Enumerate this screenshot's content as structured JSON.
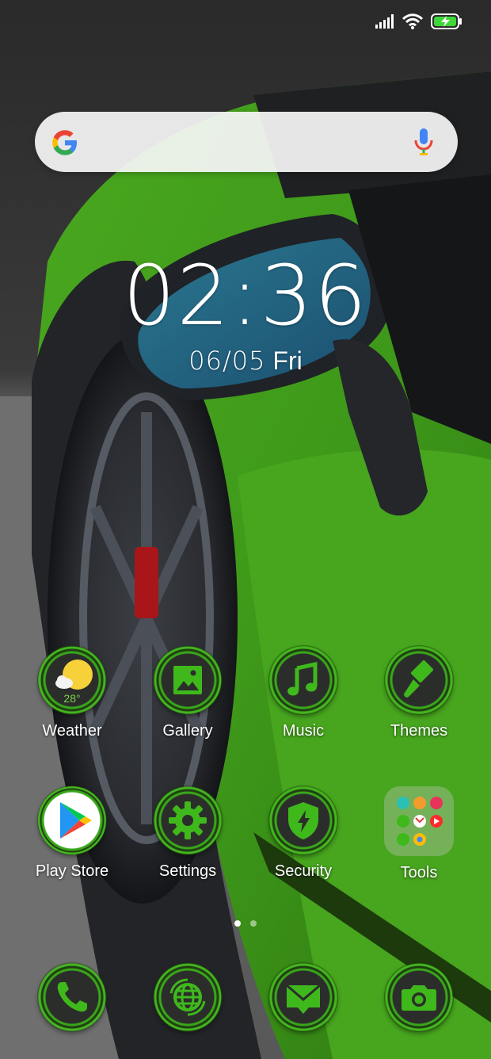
{
  "status_bar": {
    "icons": [
      "signal-icon",
      "wifi-icon",
      "battery-charging-icon"
    ]
  },
  "search": {
    "placeholder": "",
    "logo": "google-g-icon",
    "mic": "mic-icon"
  },
  "clock": {
    "time": "02:36",
    "date": "06/05",
    "weekday": "Fri"
  },
  "apps": {
    "row1": [
      {
        "label": "Weather",
        "icon": "weather-icon",
        "temp": "28°"
      },
      {
        "label": "Gallery",
        "icon": "gallery-icon"
      },
      {
        "label": "Music",
        "icon": "music-icon"
      },
      {
        "label": "Themes",
        "icon": "themes-brush-icon"
      }
    ],
    "row2": [
      {
        "label": "Play Store",
        "icon": "play-store-icon"
      },
      {
        "label": "Settings",
        "icon": "gear-icon"
      },
      {
        "label": "Security",
        "icon": "shield-icon"
      },
      {
        "label": "Tools",
        "icon": "folder-icon"
      }
    ]
  },
  "page_indicator": {
    "pages": 2,
    "current": 1
  },
  "dock": [
    {
      "icon": "phone-icon"
    },
    {
      "icon": "browser-globe-icon"
    },
    {
      "icon": "messaging-icon"
    },
    {
      "icon": "camera-icon"
    }
  ],
  "colors": {
    "accent": "#3fb81c",
    "icon_bg": "#2b2d2b"
  }
}
